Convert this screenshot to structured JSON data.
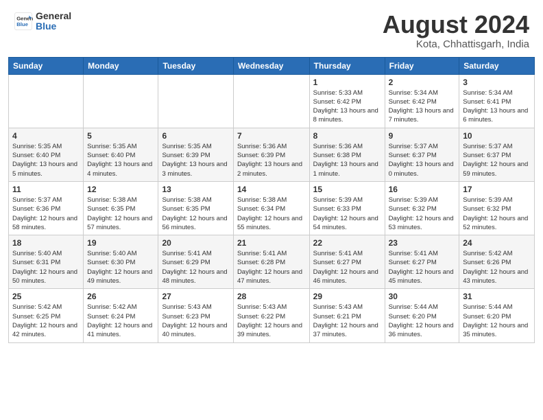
{
  "header": {
    "logo_general": "General",
    "logo_blue": "Blue",
    "month_year": "August 2024",
    "location": "Kota, Chhattisgarh, India"
  },
  "days_of_week": [
    "Sunday",
    "Monday",
    "Tuesday",
    "Wednesday",
    "Thursday",
    "Friday",
    "Saturday"
  ],
  "weeks": [
    [
      {
        "day": "",
        "info": ""
      },
      {
        "day": "",
        "info": ""
      },
      {
        "day": "",
        "info": ""
      },
      {
        "day": "",
        "info": ""
      },
      {
        "day": "1",
        "info": "Sunrise: 5:33 AM\nSunset: 6:42 PM\nDaylight: 13 hours\nand 8 minutes."
      },
      {
        "day": "2",
        "info": "Sunrise: 5:34 AM\nSunset: 6:42 PM\nDaylight: 13 hours\nand 7 minutes."
      },
      {
        "day": "3",
        "info": "Sunrise: 5:34 AM\nSunset: 6:41 PM\nDaylight: 13 hours\nand 6 minutes."
      }
    ],
    [
      {
        "day": "4",
        "info": "Sunrise: 5:35 AM\nSunset: 6:40 PM\nDaylight: 13 hours\nand 5 minutes."
      },
      {
        "day": "5",
        "info": "Sunrise: 5:35 AM\nSunset: 6:40 PM\nDaylight: 13 hours\nand 4 minutes."
      },
      {
        "day": "6",
        "info": "Sunrise: 5:35 AM\nSunset: 6:39 PM\nDaylight: 13 hours\nand 3 minutes."
      },
      {
        "day": "7",
        "info": "Sunrise: 5:36 AM\nSunset: 6:39 PM\nDaylight: 13 hours\nand 2 minutes."
      },
      {
        "day": "8",
        "info": "Sunrise: 5:36 AM\nSunset: 6:38 PM\nDaylight: 13 hours\nand 1 minute."
      },
      {
        "day": "9",
        "info": "Sunrise: 5:37 AM\nSunset: 6:37 PM\nDaylight: 13 hours\nand 0 minutes."
      },
      {
        "day": "10",
        "info": "Sunrise: 5:37 AM\nSunset: 6:37 PM\nDaylight: 12 hours\nand 59 minutes."
      }
    ],
    [
      {
        "day": "11",
        "info": "Sunrise: 5:37 AM\nSunset: 6:36 PM\nDaylight: 12 hours\nand 58 minutes."
      },
      {
        "day": "12",
        "info": "Sunrise: 5:38 AM\nSunset: 6:35 PM\nDaylight: 12 hours\nand 57 minutes."
      },
      {
        "day": "13",
        "info": "Sunrise: 5:38 AM\nSunset: 6:35 PM\nDaylight: 12 hours\nand 56 minutes."
      },
      {
        "day": "14",
        "info": "Sunrise: 5:38 AM\nSunset: 6:34 PM\nDaylight: 12 hours\nand 55 minutes."
      },
      {
        "day": "15",
        "info": "Sunrise: 5:39 AM\nSunset: 6:33 PM\nDaylight: 12 hours\nand 54 minutes."
      },
      {
        "day": "16",
        "info": "Sunrise: 5:39 AM\nSunset: 6:32 PM\nDaylight: 12 hours\nand 53 minutes."
      },
      {
        "day": "17",
        "info": "Sunrise: 5:39 AM\nSunset: 6:32 PM\nDaylight: 12 hours\nand 52 minutes."
      }
    ],
    [
      {
        "day": "18",
        "info": "Sunrise: 5:40 AM\nSunset: 6:31 PM\nDaylight: 12 hours\nand 50 minutes."
      },
      {
        "day": "19",
        "info": "Sunrise: 5:40 AM\nSunset: 6:30 PM\nDaylight: 12 hours\nand 49 minutes."
      },
      {
        "day": "20",
        "info": "Sunrise: 5:41 AM\nSunset: 6:29 PM\nDaylight: 12 hours\nand 48 minutes."
      },
      {
        "day": "21",
        "info": "Sunrise: 5:41 AM\nSunset: 6:28 PM\nDaylight: 12 hours\nand 47 minutes."
      },
      {
        "day": "22",
        "info": "Sunrise: 5:41 AM\nSunset: 6:27 PM\nDaylight: 12 hours\nand 46 minutes."
      },
      {
        "day": "23",
        "info": "Sunrise: 5:41 AM\nSunset: 6:27 PM\nDaylight: 12 hours\nand 45 minutes."
      },
      {
        "day": "24",
        "info": "Sunrise: 5:42 AM\nSunset: 6:26 PM\nDaylight: 12 hours\nand 43 minutes."
      }
    ],
    [
      {
        "day": "25",
        "info": "Sunrise: 5:42 AM\nSunset: 6:25 PM\nDaylight: 12 hours\nand 42 minutes."
      },
      {
        "day": "26",
        "info": "Sunrise: 5:42 AM\nSunset: 6:24 PM\nDaylight: 12 hours\nand 41 minutes."
      },
      {
        "day": "27",
        "info": "Sunrise: 5:43 AM\nSunset: 6:23 PM\nDaylight: 12 hours\nand 40 minutes."
      },
      {
        "day": "28",
        "info": "Sunrise: 5:43 AM\nSunset: 6:22 PM\nDaylight: 12 hours\nand 39 minutes."
      },
      {
        "day": "29",
        "info": "Sunrise: 5:43 AM\nSunset: 6:21 PM\nDaylight: 12 hours\nand 37 minutes."
      },
      {
        "day": "30",
        "info": "Sunrise: 5:44 AM\nSunset: 6:20 PM\nDaylight: 12 hours\nand 36 minutes."
      },
      {
        "day": "31",
        "info": "Sunrise: 5:44 AM\nSunset: 6:20 PM\nDaylight: 12 hours\nand 35 minutes."
      }
    ]
  ]
}
